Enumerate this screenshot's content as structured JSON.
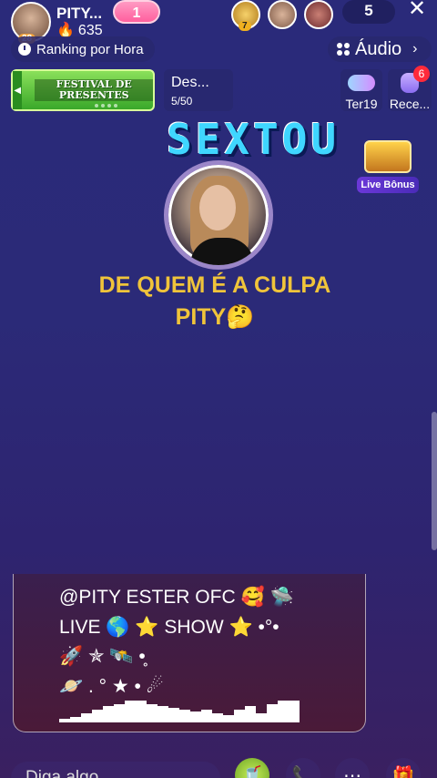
{
  "host": {
    "name": "PITY...",
    "fans": "635",
    "level": "28",
    "follow_count": "1"
  },
  "viewers": {
    "badge": "7",
    "count": "5"
  },
  "ranking": {
    "label": "Ranking por Hora"
  },
  "audio": {
    "label": "Áudio"
  },
  "festival": {
    "text": "FESTIVAL DE PRESENTES"
  },
  "desafio": {
    "title": "Des...",
    "progress": "5/50"
  },
  "side_buttons": {
    "ter": "Ter19",
    "rece": "Rece...",
    "rece_badge": "6"
  },
  "banner": {
    "text": "SEXTOU"
  },
  "live_bonus": {
    "label": "Live Bônus"
  },
  "room_title": {
    "line1": "DE QUEM É A CULPA",
    "line2": "PITY🤔"
  },
  "bio": {
    "line1": "@PITY ESTER OFC 🥰 🛸",
    "line2": "LIVE    🌎 ⭐ SHOW  ⭐      •°•",
    "line3": "🚀 ✯                   🛰️       •̥",
    "line4": "🪐 .               ° ★   • ☄"
  },
  "bottom": {
    "placeholder": "Diga algo..."
  }
}
